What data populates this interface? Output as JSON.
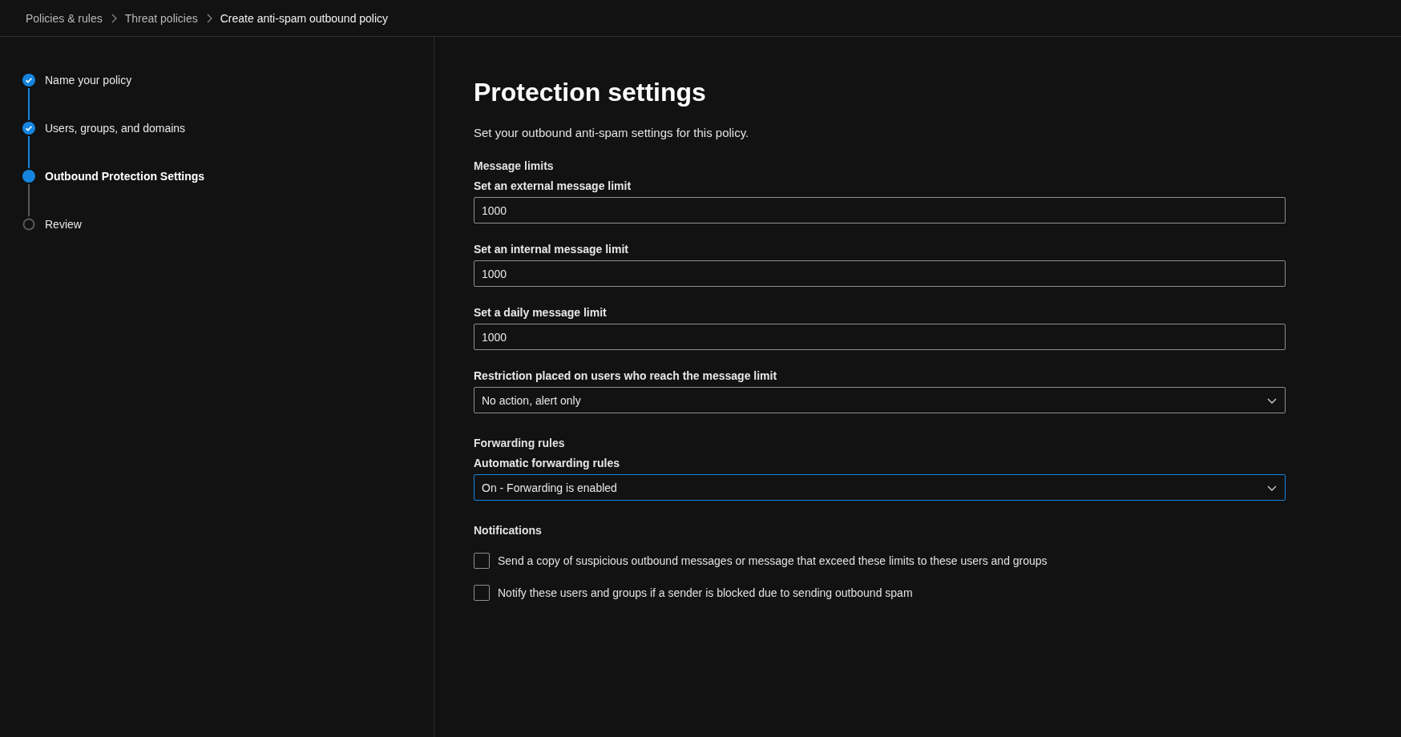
{
  "breadcrumb": [
    {
      "label": "Policies & rules",
      "current": false
    },
    {
      "label": "Threat policies",
      "current": false
    },
    {
      "label": "Create anti-spam outbound policy",
      "current": true
    }
  ],
  "steps": [
    {
      "label": "Name your policy",
      "completed": true,
      "selected": false
    },
    {
      "label": "Users, groups, and domains",
      "completed": true,
      "selected": false
    },
    {
      "label": "Outbound Protection Settings",
      "completed": false,
      "selected": true
    },
    {
      "label": "Review",
      "completed": false,
      "selected": false
    }
  ],
  "page": {
    "title": "Protection settings",
    "description": "Set your outbound anti-spam settings for this policy."
  },
  "sections": [
    {
      "heading": "Message limits",
      "fields": [
        {
          "kind": "text",
          "label": "Set an external message limit",
          "value": "1000"
        },
        {
          "kind": "text",
          "label": "Set an internal message limit",
          "value": "1000"
        },
        {
          "kind": "text",
          "label": "Set a daily message limit",
          "value": "1000"
        },
        {
          "kind": "dropdown",
          "label": "Restriction placed on users who reach the message limit",
          "value": "No action, alert only",
          "focused": false
        }
      ]
    },
    {
      "heading": "Forwarding rules",
      "fields": [
        {
          "kind": "dropdown",
          "label": "Automatic forwarding rules",
          "value": "On - Forwarding is enabled",
          "focused": true
        }
      ]
    },
    {
      "heading": "Notifications",
      "fields": [
        {
          "kind": "checkbox",
          "label": "Send a copy of suspicious outbound messages or message that exceed these limits to these users and groups",
          "checked": false
        },
        {
          "kind": "checkbox",
          "label": "Notify these users and groups if a sender is blocked due to sending outbound spam",
          "checked": false
        }
      ]
    }
  ]
}
